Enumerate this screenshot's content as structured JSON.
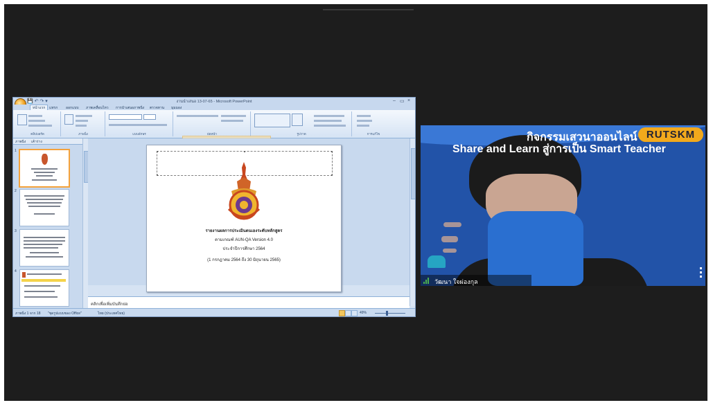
{
  "powerpoint": {
    "window_title": "งานนำเสนอ 13-07-65 - Microsoft PowerPoint",
    "window_controls": [
      "–",
      "▭",
      "×"
    ],
    "ribbon_tabs": [
      "หน้าแรก",
      "แทรก",
      "ออกแบบ",
      "ภาพเคลื่อนไหว",
      "การนำเสนอภาพนิ่ง",
      "ตรวจทาน",
      "มุมมอง"
    ],
    "ribbon_groups": [
      "คลิปบอร์ด",
      "ภาพนิ่ง",
      "แบบอักษร",
      "ย่อหน้า",
      "รูปวาด",
      "การแก้ไข"
    ],
    "panel_tabs": [
      "ภาพนิ่ง",
      "เค้าร่าง"
    ],
    "thumbnails": [
      {
        "number": "1"
      },
      {
        "number": "2"
      },
      {
        "number": "3"
      },
      {
        "number": "4"
      }
    ],
    "slide": {
      "line1": "รายงานผลการประเมินตนเองระดับหลักสูตร",
      "line2": "ตามเกณฑ์ AUN-QA Version 4.0",
      "line3": "ประจำปีการศึกษา 2564",
      "line4": "(1 กรกฎาคม 2564 ถึง 30 มิถุนายน 2565)"
    },
    "notes_placeholder": "คลิกเพื่อเพิ่มบันทึกย่อ",
    "status": {
      "slide_info": "ภาพนิ่ง 1 จาก 18",
      "theme": "\"ชุดรูปแบบของ Office\"",
      "language": "ไทย (ประเทศไทย)",
      "zoom": "49%"
    }
  },
  "webcam": {
    "banner_line1": "กิจกรรมเสวนาออนไลน์",
    "badge": "RUTSKM",
    "banner_line2": "Share and Learn สู่การเป็น Smart Teacher",
    "participant_name": "วัฒนา ใจผ่องกุล",
    "colors": {
      "background": "#2253a8",
      "badge": "#f2a91c"
    }
  }
}
